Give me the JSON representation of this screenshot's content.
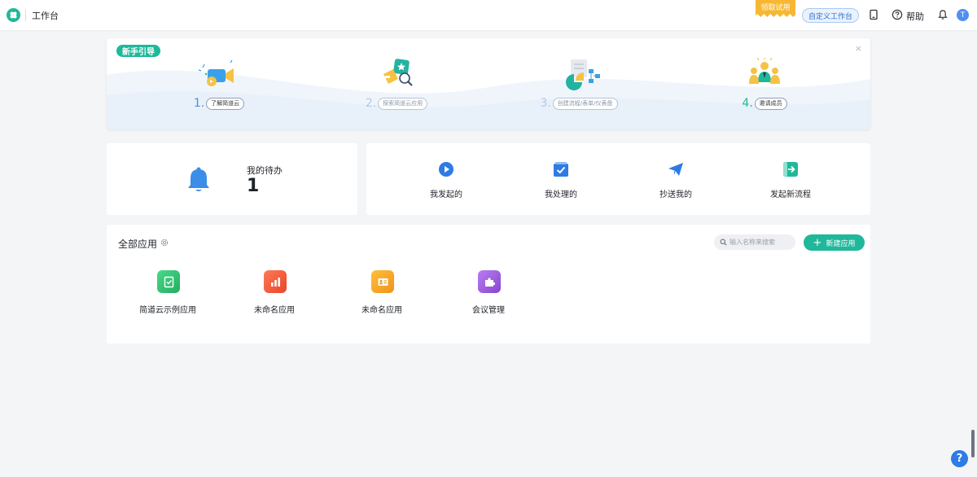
{
  "topbar": {
    "title": "工作台",
    "trial_badge": "领取试用",
    "custom_button": "自定义工作台",
    "help_label": "帮助",
    "avatar_initial": "T"
  },
  "guide": {
    "tag": "新手引导",
    "close_glyph": "×",
    "steps": [
      {
        "num": "1.",
        "label": "了解简道云",
        "active": true
      },
      {
        "num": "2.",
        "label": "探索简道云应用",
        "active": false
      },
      {
        "num": "3.",
        "label": "创建流程/表单/仪表盘",
        "active": false
      },
      {
        "num": "4.",
        "label": "邀请成员",
        "active": true
      }
    ]
  },
  "todo": {
    "label": "我的待办",
    "count": "1"
  },
  "process": {
    "items": [
      {
        "label": "我发起的",
        "icon": "play-circle-icon"
      },
      {
        "label": "我处理的",
        "icon": "check-box-icon"
      },
      {
        "label": "抄送我的",
        "icon": "paper-plane-icon"
      },
      {
        "label": "发起新流程",
        "icon": "enter-flow-icon"
      }
    ]
  },
  "apps": {
    "title": "全部应用",
    "search_placeholder": "输入名称来搜索",
    "new_button": "新建应用",
    "new_button_glyph": "+",
    "items": [
      {
        "label": "简道云示例应用",
        "icon": "check-doc-icon",
        "color": "#2fbf71"
      },
      {
        "label": "未命名应用",
        "icon": "bar-chart-icon",
        "color": "#f05a3a"
      },
      {
        "label": "未命名应用",
        "icon": "id-card-icon",
        "color": "#f4a21e"
      },
      {
        "label": "会议管理",
        "icon": "puzzle-icon",
        "color": "#9b59d8"
      }
    ]
  },
  "help_fab": "?"
}
